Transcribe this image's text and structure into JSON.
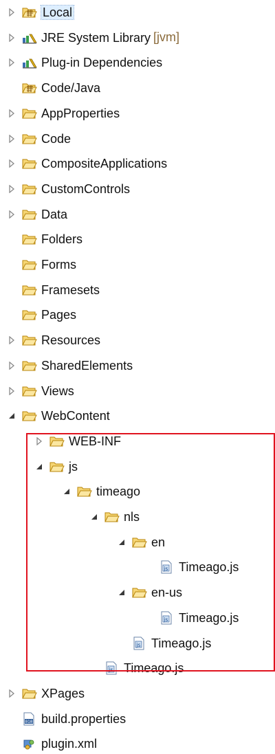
{
  "tree": [
    {
      "label": "Local",
      "decoration": "",
      "indent": 0,
      "twisty": "collapsed",
      "icon": "package-folder-icon",
      "selected": true
    },
    {
      "label": "JRE System Library",
      "decoration": "[jvm]",
      "indent": 0,
      "twisty": "collapsed",
      "icon": "library-icon",
      "selected": false
    },
    {
      "label": "Plug-in Dependencies",
      "decoration": "",
      "indent": 0,
      "twisty": "collapsed",
      "icon": "library-icon",
      "selected": false
    },
    {
      "label": "Code/Java",
      "decoration": "",
      "indent": 0,
      "twisty": "none",
      "icon": "package-folder-icon",
      "selected": false
    },
    {
      "label": "AppProperties",
      "decoration": "",
      "indent": 0,
      "twisty": "collapsed",
      "icon": "folder-icon",
      "selected": false
    },
    {
      "label": "Code",
      "decoration": "",
      "indent": 0,
      "twisty": "collapsed",
      "icon": "folder-icon",
      "selected": false
    },
    {
      "label": "CompositeApplications",
      "decoration": "",
      "indent": 0,
      "twisty": "collapsed",
      "icon": "folder-icon",
      "selected": false
    },
    {
      "label": "CustomControls",
      "decoration": "",
      "indent": 0,
      "twisty": "collapsed",
      "icon": "folder-icon",
      "selected": false
    },
    {
      "label": "Data",
      "decoration": "",
      "indent": 0,
      "twisty": "collapsed",
      "icon": "folder-icon",
      "selected": false
    },
    {
      "label": "Folders",
      "decoration": "",
      "indent": 0,
      "twisty": "none",
      "icon": "folder-icon",
      "selected": false
    },
    {
      "label": "Forms",
      "decoration": "",
      "indent": 0,
      "twisty": "none",
      "icon": "folder-icon",
      "selected": false
    },
    {
      "label": "Framesets",
      "decoration": "",
      "indent": 0,
      "twisty": "none",
      "icon": "folder-icon",
      "selected": false
    },
    {
      "label": "Pages",
      "decoration": "",
      "indent": 0,
      "twisty": "none",
      "icon": "folder-icon",
      "selected": false
    },
    {
      "label": "Resources",
      "decoration": "",
      "indent": 0,
      "twisty": "collapsed",
      "icon": "folder-icon",
      "selected": false
    },
    {
      "label": "SharedElements",
      "decoration": "",
      "indent": 0,
      "twisty": "collapsed",
      "icon": "folder-icon",
      "selected": false
    },
    {
      "label": "Views",
      "decoration": "",
      "indent": 0,
      "twisty": "collapsed",
      "icon": "folder-icon",
      "selected": false
    },
    {
      "label": "WebContent",
      "decoration": "",
      "indent": 0,
      "twisty": "expanded",
      "icon": "folder-icon",
      "selected": false
    },
    {
      "label": "WEB-INF",
      "decoration": "",
      "indent": 1,
      "twisty": "collapsed",
      "icon": "folder-icon",
      "selected": false
    },
    {
      "label": "js",
      "decoration": "",
      "indent": 1,
      "twisty": "expanded",
      "icon": "folder-icon",
      "selected": false
    },
    {
      "label": "timeago",
      "decoration": "",
      "indent": 2,
      "twisty": "expanded",
      "icon": "folder-icon",
      "selected": false
    },
    {
      "label": "nls",
      "decoration": "",
      "indent": 3,
      "twisty": "expanded",
      "icon": "folder-icon",
      "selected": false
    },
    {
      "label": "en",
      "decoration": "",
      "indent": 4,
      "twisty": "expanded",
      "icon": "folder-icon",
      "selected": false
    },
    {
      "label": "Timeago.js",
      "decoration": "",
      "indent": 5,
      "twisty": "none",
      "icon": "js-file-icon",
      "selected": false
    },
    {
      "label": "en-us",
      "decoration": "",
      "indent": 4,
      "twisty": "expanded",
      "icon": "folder-icon",
      "selected": false
    },
    {
      "label": "Timeago.js",
      "decoration": "",
      "indent": 5,
      "twisty": "none",
      "icon": "js-file-icon",
      "selected": false
    },
    {
      "label": "Timeago.js",
      "decoration": "",
      "indent": 4,
      "twisty": "none",
      "icon": "js-file-icon",
      "selected": false
    },
    {
      "label": "Timeago.js",
      "decoration": "",
      "indent": 3,
      "twisty": "none",
      "icon": "js-file-icon",
      "selected": false
    },
    {
      "label": "XPages",
      "decoration": "",
      "indent": 0,
      "twisty": "collapsed",
      "icon": "folder-icon",
      "selected": false
    },
    {
      "label": "build.properties",
      "decoration": "",
      "indent": 0,
      "twisty": "none",
      "icon": "properties-file-icon",
      "selected": false
    },
    {
      "label": "plugin.xml",
      "decoration": "",
      "indent": 0,
      "twisty": "none",
      "icon": "plugin-file-icon",
      "selected": false
    }
  ],
  "colors": {
    "highlight_border": "#e0121e",
    "folder_fill": "#f3cf63",
    "folder_stroke": "#b8860b",
    "decoration_text": "#8a6a3a"
  }
}
